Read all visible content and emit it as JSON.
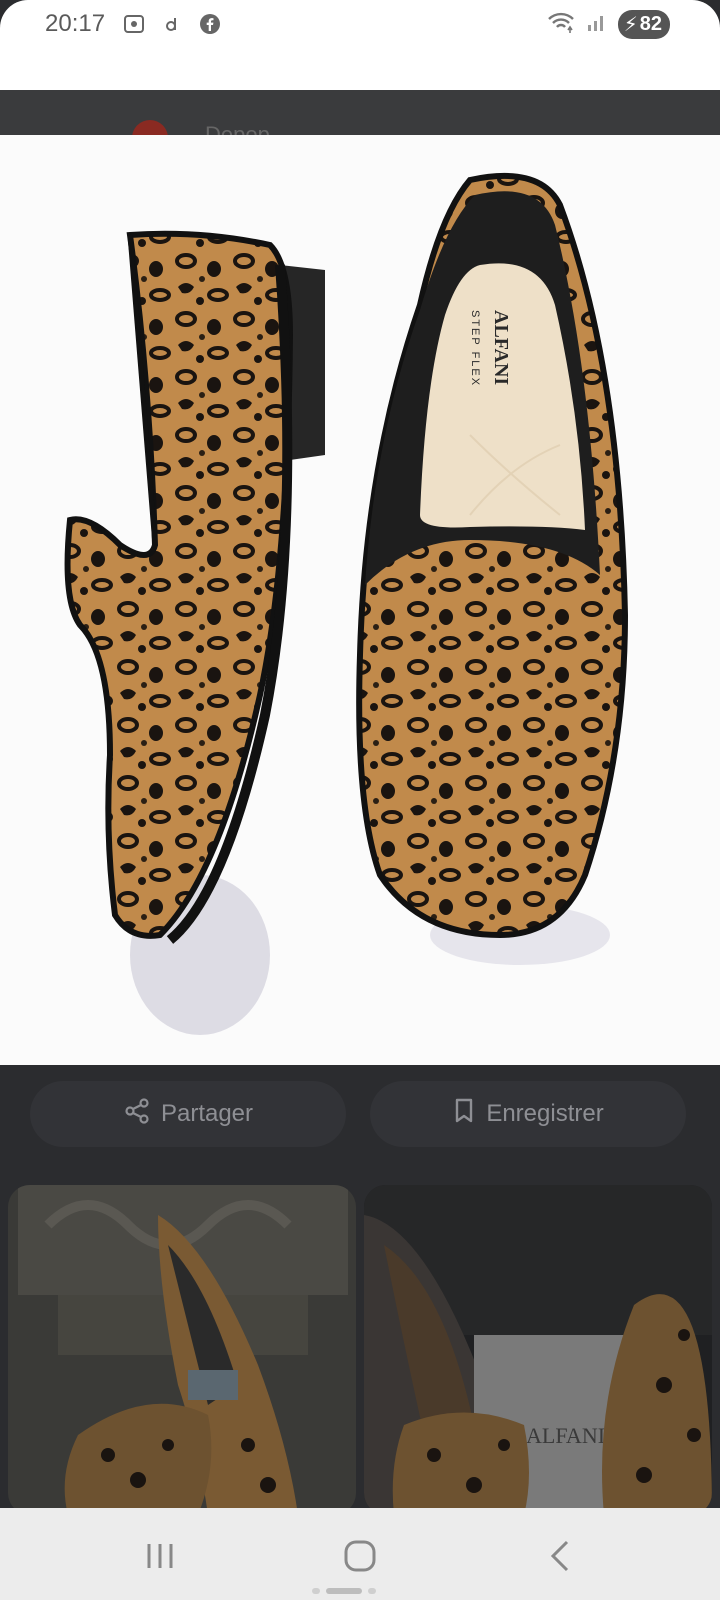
{
  "status": {
    "time": "20:17",
    "battery": "82"
  },
  "background_header": {
    "text": "Depop"
  },
  "main_image": {
    "brand_insole_line1": "ALFANI",
    "brand_insole_line2": "STEP FLEX"
  },
  "actions": {
    "share_label": "Partager",
    "save_label": "Enregistrer"
  },
  "thumbnails": [
    {
      "label": ""
    },
    {
      "box_text": "ALFANI"
    }
  ],
  "colors": {
    "leopard_base": "#c08a4a",
    "leopard_spot": "#1a1410",
    "insole": "#eee0c8",
    "page_dark": "#2b2c2f"
  }
}
